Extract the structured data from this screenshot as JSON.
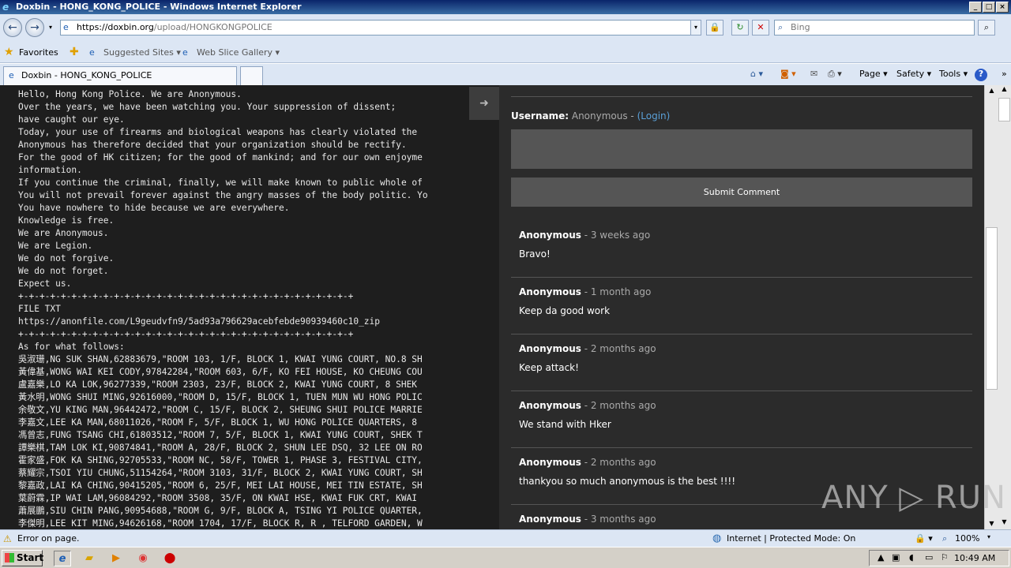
{
  "window": {
    "title": "Doxbin - HONG_KONG_POLICE - Windows Internet Explorer",
    "min": "_",
    "max": "□",
    "close": "×"
  },
  "address": {
    "url_domain": "https://doxbin.org",
    "url_path": "/upload/HONGKONGPOLICE",
    "search_placeholder": "Bing"
  },
  "favorites": {
    "label": "Favorites",
    "suggested": "Suggested Sites ▾",
    "webslice": "Web Slice Gallery ▾"
  },
  "tab": {
    "label": "Doxbin - HONG_KONG_POLICE"
  },
  "commands": {
    "page": "Page ▾",
    "safety": "Safety ▾",
    "tools": "Tools ▾",
    "help": "?"
  },
  "paste_lines": [
    "Hello, Hong Kong Police. We are Anonymous.",
    "Over the years, we have been watching you. Your suppression of dissent;",
    "have caught our eye.",
    "Today, your use of firearms and biological weapons has clearly violated the",
    "Anonymous has therefore decided that your organization should be rectify.",
    "For the good of HK citizen; for the good of mankind; and for our own enjoyme",
    "information.",
    "If you continue the criminal, finally, we will make known to public whole of",
    "You will not prevail forever against the angry masses of the body politic. Yo",
    "You have nowhere to hide because we are everywhere.",
    "Knowledge is free.",
    "We are Anonymous.",
    "We are Legion.",
    "We do not forgive.",
    "We do not forget.",
    "Expect us.",
    "+-+-+-+-+-+-+-+-+-+-+-+-+-+-+-+-+-+-+-+-+-+-+-+-+-+-+-+-+-+-+-+",
    "FILE TXT",
    "https://anonfile.com/L9geudvfn9/5ad93a796629acebfebde90939460c10_zip",
    "+-+-+-+-+-+-+-+-+-+-+-+-+-+-+-+-+-+-+-+-+-+-+-+-+-+-+-+-+-+-+-+",
    "As for what follows:",
    "吳淑珊,NG SUK SHAN,62883679,\"ROOM 103, 1/F, BLOCK 1, KWAI YUNG COURT, NO.8 SH",
    "黃偉基,WONG WAI KEI CODY,97842284,\"ROOM 603, 6/F, KO FEI HOUSE, KO CHEUNG COU",
    "盧嘉樂,LO KA LOK,96277339,\"ROOM 2303, 23/F, BLOCK 2, KWAI YUNG COURT, 8 SHEK",
    "黃水明,WONG SHUI MING,92616000,\"ROOM D, 15/F, BLOCK 1, TUEN MUN WU HONG POLIC",
    "余敬文,YU KING MAN,96442472,\"ROOM C, 15/F, BLOCK 2, SHEUNG SHUI POLICE MARRIE",
    "李嘉文,LEE KA MAN,68011026,\"ROOM F, 5/F, BLOCK 1, WU HONG POLICE QUARTERS, 8",
    "馮曾志,FUNG TSANG CHI,61803512,\"ROOM 7, 5/F, BLOCK 1, KWAI YUNG COURT, SHEK T",
    "譚樂棋,TAM LOK KI,90874841,\"ROOM A, 28/F, BLOCK 2, SHUN LEE DSQ, 32 LEE ON RO",
    "霍家盛,FOK KA SHING,92705533,\"ROOM NC, 58/F, TOWER 1, PHASE 3, FESTIVAL CITY,",
    "蔡耀宗,TSOI YIU CHUNG,51154264,\"ROOM 3103, 31/F, BLOCK 2, KWAI YUNG COURT, SH",
    "黎嘉政,LAI KA CHING,90415205,\"ROOM 6, 25/F, MEI LAI HOUSE, MEI TIN ESTATE, SH",
    "葉蔚霖,IP WAI LAM,96084292,\"ROOM 3508, 35/F, ON KWAI HSE, KWAI FUK CRT, KWAI",
    "蕭展鵬,SIU CHIN PANG,90954688,\"ROOM G, 9/F, BLOCK A, TSING YI POLICE QUARTER,",
    "李傑明,LEE KIT MING,94626168,\"ROOM 1704, 17/F, BLOCK R, R , TELFORD GARDEN, W"
  ],
  "comments_panel": {
    "username_label": "Username:",
    "username_value": "Anonymous - ",
    "login": "(Login)",
    "submit": "Submit Comment",
    "comments": [
      {
        "author": "Anonymous",
        "time": " - 3 weeks ago",
        "text": "Bravo!"
      },
      {
        "author": "Anonymous",
        "time": " - 1 month ago",
        "text": "Keep da good work"
      },
      {
        "author": "Anonymous",
        "time": " - 2 months ago",
        "text": "Keep attack!"
      },
      {
        "author": "Anonymous",
        "time": " - 2 months ago",
        "text": "We stand with Hker"
      },
      {
        "author": "Anonymous",
        "time": " - 2 months ago",
        "text": "thankyou so much anonymous is the best !!!!"
      },
      {
        "author": "Anonymous",
        "time": " - 3 months ago",
        "text": ""
      }
    ]
  },
  "watermark": "ANY ▷ RUN",
  "status": {
    "error": "Error on page.",
    "zone": "Internet | Protected Mode: On",
    "zoom": "100%"
  },
  "taskbar": {
    "start": "Start",
    "clock": "10:49 AM"
  }
}
